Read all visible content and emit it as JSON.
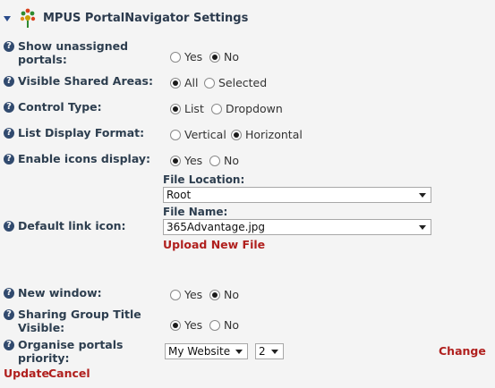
{
  "header": {
    "title": "MPUS PortalNavigator Settings",
    "caret_icon": "caret-down-icon",
    "logo_icon": "flower-logo"
  },
  "settings": [
    {
      "label": "Show unassigned portals:",
      "options": [
        "Yes",
        "No"
      ],
      "selected": "No"
    },
    {
      "label": "Visible Shared Areas:",
      "options": [
        "All",
        "Selected"
      ],
      "selected": "All"
    },
    {
      "label": "Control Type:",
      "options": [
        "List",
        "Dropdown"
      ],
      "selected": "List"
    },
    {
      "label": "List Display Format:",
      "options": [
        "Vertical",
        "Horizontal"
      ],
      "selected": "Horizontal"
    },
    {
      "label": "Enable icons display:",
      "options": [
        "Yes",
        "No"
      ],
      "selected": "Yes"
    }
  ],
  "default_link_icon": {
    "label": "Default link icon:",
    "file_location_caption": "File Location:",
    "file_location_value": "Root",
    "file_name_caption": "File Name:",
    "file_name_value": "365Advantage.jpg",
    "upload_label": "Upload New File"
  },
  "settings2": [
    {
      "label": "New window:",
      "options": [
        "Yes",
        "No"
      ],
      "selected": "No"
    },
    {
      "label": "Sharing Group Title Visible:",
      "options": [
        "Yes",
        "No"
      ],
      "selected": "Yes"
    }
  ],
  "organise": {
    "label": "Organise portals priority:",
    "portal_value": "My Website",
    "priority_value": "2",
    "change_label": "Change"
  },
  "footer": {
    "update_label": "Update",
    "cancel_label": "Cancel"
  },
  "colors": {
    "accent_red": "#b0201e",
    "label_navy": "#2d3e4f",
    "background": "#f4f4f4"
  }
}
